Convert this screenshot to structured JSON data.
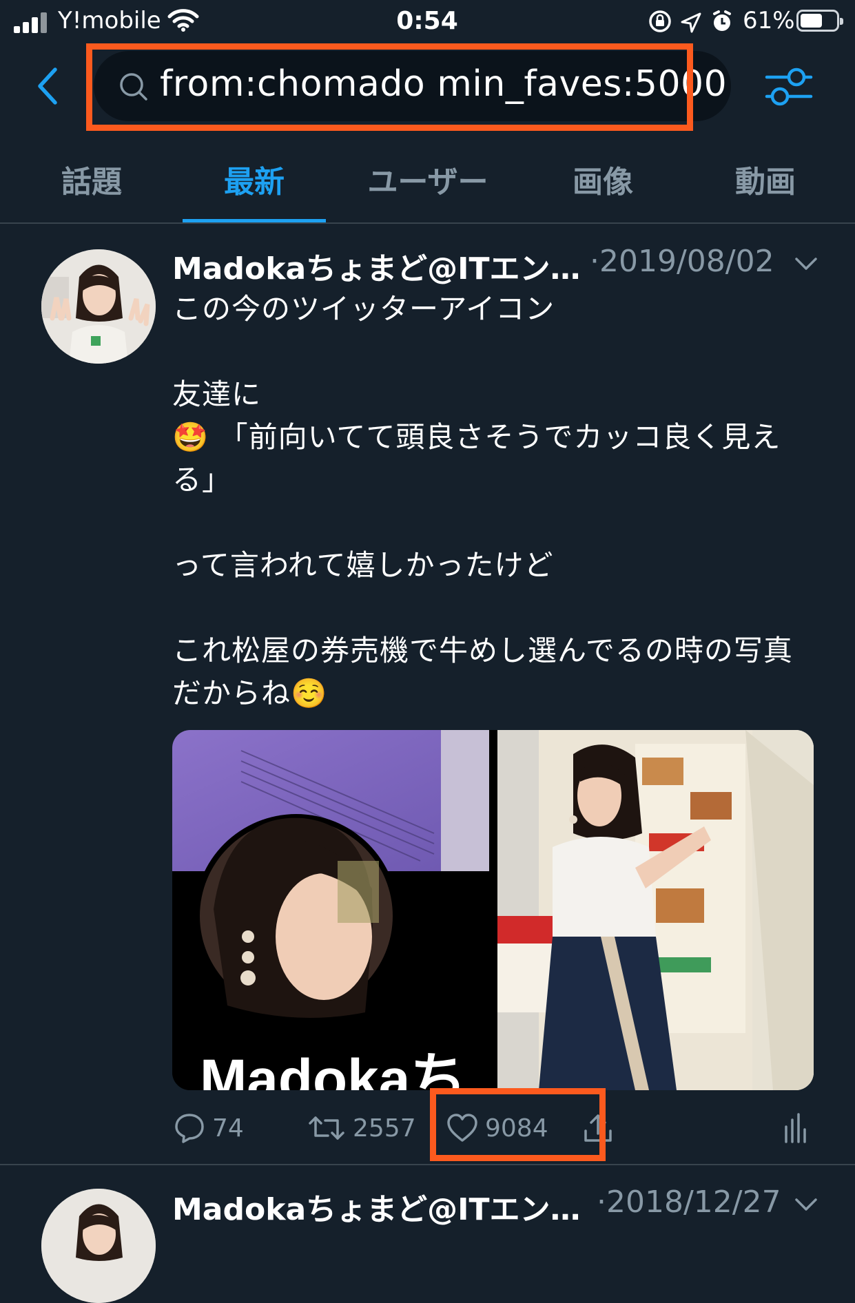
{
  "status_bar": {
    "carrier": "Y!mobile",
    "time": "0:54",
    "battery_percent": "61%",
    "battery_level": 0.61,
    "icons": [
      "signal-icon",
      "wifi-icon",
      "rotation-lock-icon",
      "location-icon",
      "alarm-icon",
      "battery-icon"
    ]
  },
  "header": {
    "back_icon": "chevron-left-icon",
    "search_icon": "search-icon",
    "search_query": "from:chomado min_faves:5000",
    "filter_icon": "sliders-icon"
  },
  "tabs": [
    {
      "label": "話題",
      "active": false
    },
    {
      "label": "最新",
      "active": true
    },
    {
      "label": "ユーザー",
      "active": false
    },
    {
      "label": "画像",
      "active": false
    },
    {
      "label": "動画",
      "active": false
    }
  ],
  "tweets": [
    {
      "author": "Madokaちょまど@ITエン…",
      "date": "·2019/08/02",
      "text": "この今のツイッターアイコン\n\n友達に\n🤩 「前向いてて頭良さそうでカッコ良く見える」\n\nって言われて嬉しかったけど\n\nこれ松屋の券売機で牛めし選んでるの時の写真だからね☺️",
      "media_caption": "Madokaち",
      "reply_count": "74",
      "retweet_count": "2557",
      "like_count": "9084"
    },
    {
      "author": "Madokaちょまど@ITエン…",
      "date": "·2018/12/27"
    }
  ],
  "colors": {
    "background": "#15202b",
    "accent": "#1da1f2",
    "muted": "#8899a6",
    "highlight": "#fc5a1e"
  }
}
